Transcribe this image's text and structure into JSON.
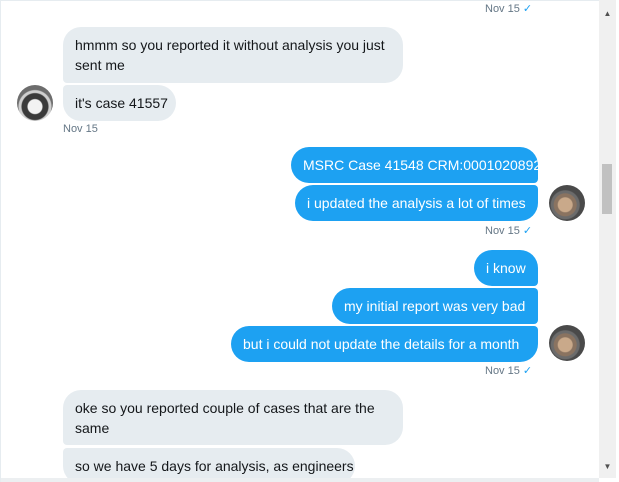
{
  "messages": {
    "ts_top": "Nov 15",
    "in1_line1": "hmmm so you reported it without analysis you just",
    "in1_line2": "sent me",
    "in2": "it's case 41557",
    "ts_in": "Nov 15",
    "out1": "MSRC Case 41548 CRM:0001020892",
    "out2": "i updated the analysis a lot of times",
    "ts_out1": "Nov 15",
    "out3": "i know",
    "out4": "my initial report was very bad",
    "out5": "but i could not update the details for a month",
    "ts_out2": "Nov 15",
    "in3_line1": "oke so you reported couple of cases that are the",
    "in3_line2": "same",
    "in4": "so we have 5 days for analysis, as engineers"
  },
  "icons": {
    "check": "✓",
    "scroll_up": "▲",
    "scroll_down": "▼"
  },
  "colors": {
    "incoming_bubble": "#e6ecf0",
    "outgoing_bubble": "#1da1f2",
    "timestamp": "#657786"
  }
}
